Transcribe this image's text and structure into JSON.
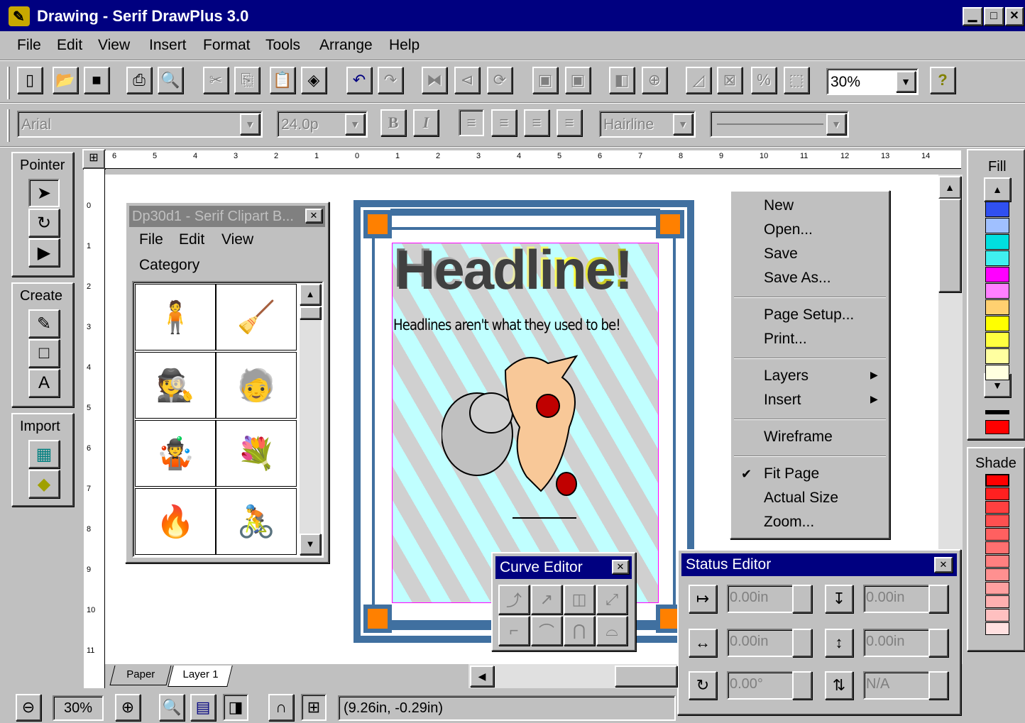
{
  "window": {
    "title": "Drawing - Serif DrawPlus 3.0",
    "minimize": "▁",
    "restore": "□",
    "close": "✕"
  },
  "menu": [
    "File",
    "Edit",
    "View",
    "Insert",
    "Format",
    "Tools",
    "Arrange",
    "Help"
  ],
  "toolbar": {
    "zoom_value": "30%",
    "help_icon": "?"
  },
  "format_bar": {
    "font": "Arial",
    "size": "24.0p",
    "bold": "B",
    "italic": "I",
    "line_weight": "Hairline"
  },
  "panels": {
    "pointer": "Pointer",
    "create": "Create",
    "import": "Import"
  },
  "ruler_h": [
    "6",
    "5",
    "4",
    "3",
    "2",
    "1",
    "0",
    "1",
    "2",
    "3",
    "4",
    "5",
    "6",
    "7",
    "8",
    "9",
    "10",
    "11",
    "12",
    "13",
    "14"
  ],
  "ruler_v": [
    "0",
    "1",
    "2",
    "3",
    "4",
    "5",
    "6",
    "7",
    "8",
    "9",
    "10",
    "11"
  ],
  "clipart": {
    "title": "Dp30d1 - Serif Clipart B...",
    "menu": [
      "File",
      "Edit",
      "View"
    ],
    "category": "Category"
  },
  "page": {
    "headline": "Headline!",
    "subhead": "Headlines aren't what they used to be!"
  },
  "context_menu": {
    "group1": [
      "New",
      "Open...",
      "Save",
      "Save As..."
    ],
    "group2": [
      "Page Setup...",
      "Print..."
    ],
    "group3": [
      "Layers",
      "Insert"
    ],
    "group4": [
      "Wireframe"
    ],
    "group5": [
      "Fit Page",
      "Actual Size",
      "Zoom..."
    ],
    "checked": "Fit Page"
  },
  "fill": {
    "label": "Fill",
    "swatches": [
      "#3050f0",
      "#a0c0ff",
      "#00e0e0",
      "#40f0f0",
      "#ff00ff",
      "#ff80ff",
      "#ffd070",
      "#ffff00",
      "#ffff40",
      "#ffffa0",
      "#ffffe0"
    ]
  },
  "shade": {
    "label": "Shade",
    "swatches": [
      "#ff0000",
      "#ff2020",
      "#ff4040",
      "#ff5050",
      "#ff6060",
      "#ff7070",
      "#ff8080",
      "#ff9090",
      "#ffa0a0",
      "#ffb0b0",
      "#ffc0c0",
      "#ffe0e0"
    ]
  },
  "curve_editor": {
    "title": "Curve Editor"
  },
  "status_editor": {
    "title": "Status Editor",
    "x": "0.00in",
    "y": "0.00in",
    "w": "0.00in",
    "h": "0.00in",
    "rotation": "0.00°",
    "skew": "N/A"
  },
  "layers": {
    "tabs": [
      "Paper",
      "Layer 1"
    ]
  },
  "statusbar": {
    "zoom": "30%",
    "coords": "(9.26in, -0.29in)"
  }
}
